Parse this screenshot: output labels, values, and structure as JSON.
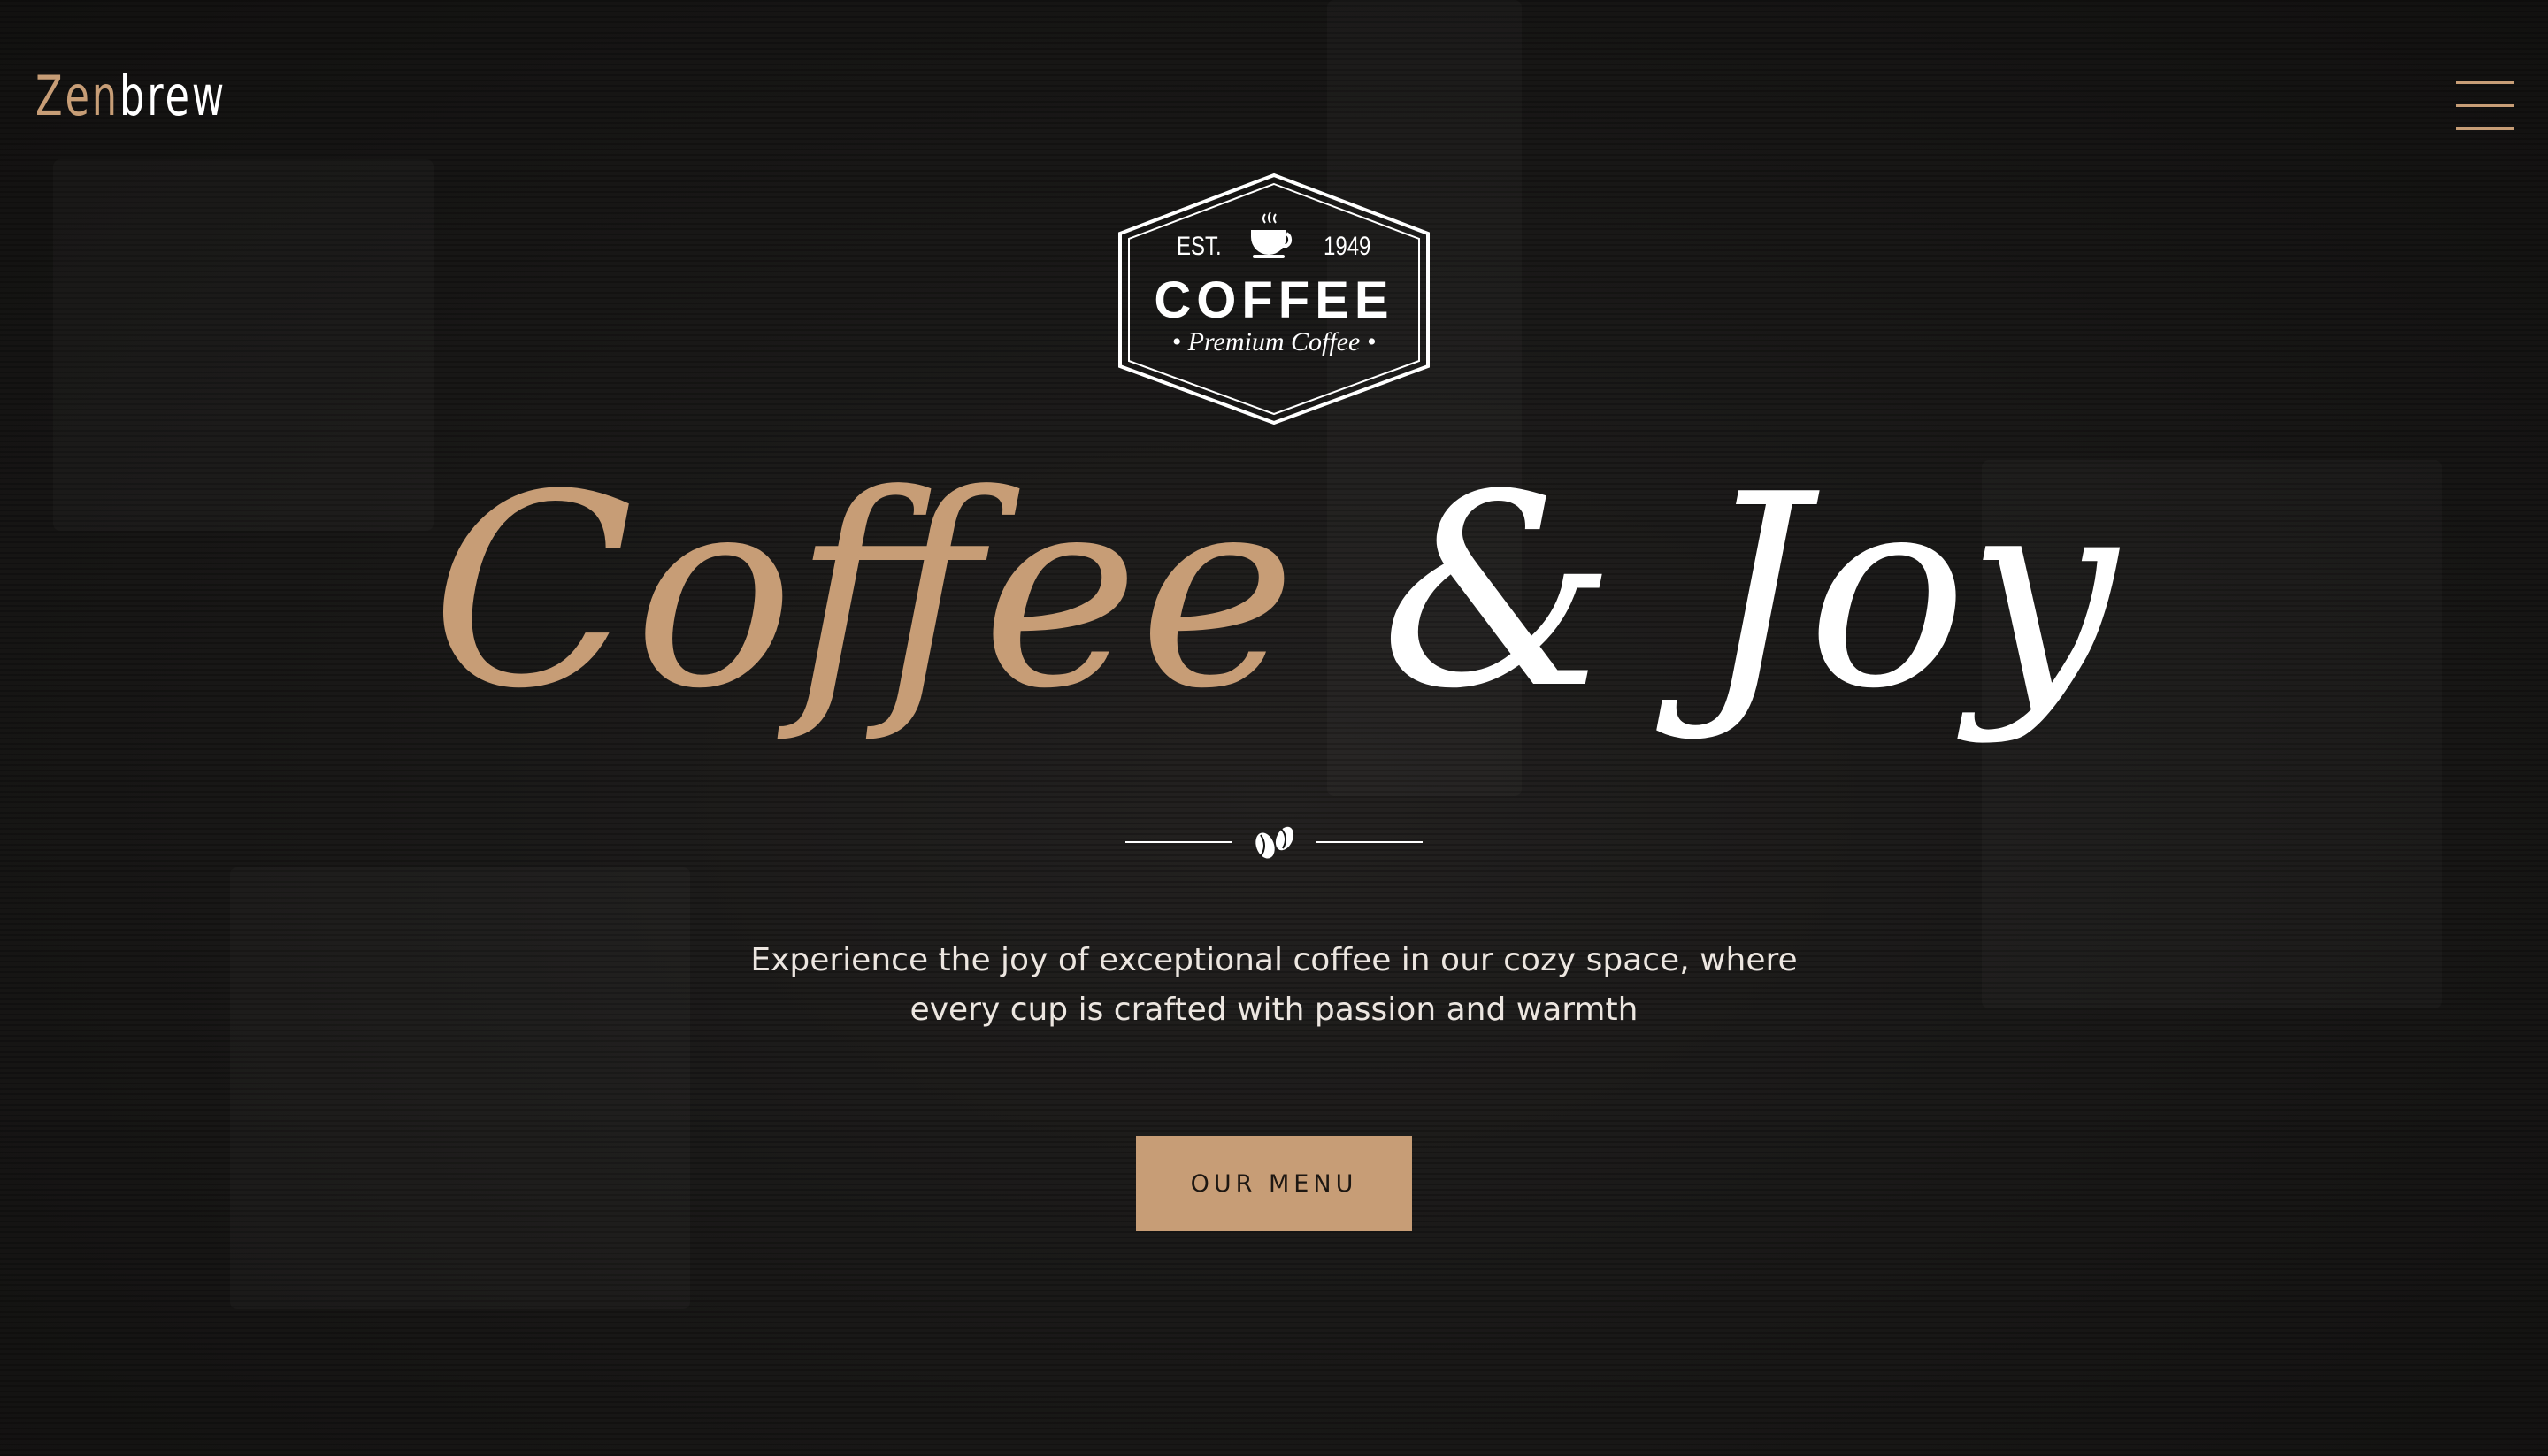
{
  "nav": {
    "brand_part1": "Zen",
    "brand_part2": "brew",
    "menu_icon": "hamburger-menu-icon"
  },
  "badge": {
    "est_label": "EST.",
    "year": "1949",
    "title": "COFFEE",
    "subtitle": "• Premium Coffee •",
    "icon": "coffee-cup-icon"
  },
  "hero": {
    "headline_part1": "Coffee",
    "headline_part2": "& Joy",
    "divider_icon": "coffee-beans-icon",
    "tagline_line1": "Experience the joy of exceptional coffee in our cozy space, where",
    "tagline_line2": "every cup is crafted with passion and warmth",
    "cta_label": "OUR MENU"
  },
  "colors": {
    "accent": "#c79d76",
    "background": "#141312",
    "text": "#ffffff",
    "button_text": "#1d1712"
  }
}
